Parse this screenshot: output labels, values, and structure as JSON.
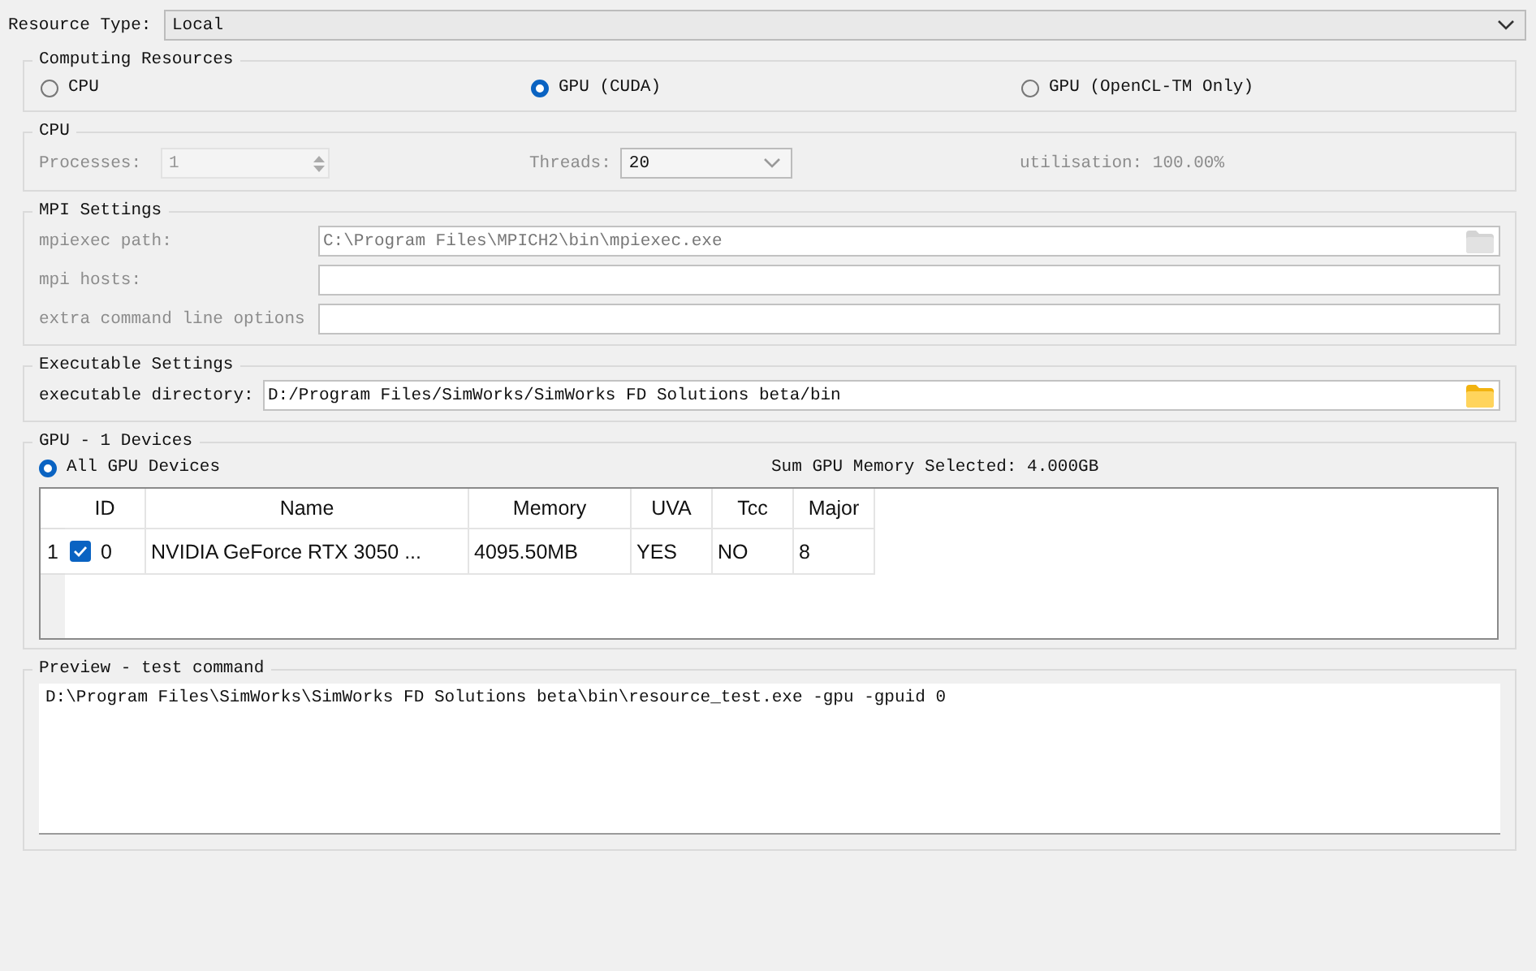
{
  "resource_type": {
    "label": "Resource Type:",
    "value": "Local"
  },
  "computing_resources": {
    "title": "Computing Resources",
    "options": [
      {
        "label": "CPU",
        "selected": false
      },
      {
        "label": "GPU (CUDA)",
        "selected": true
      },
      {
        "label": "GPU (OpenCL-TM Only)",
        "selected": false
      }
    ]
  },
  "cpu": {
    "title": "CPU",
    "processes_label": "Processes:",
    "processes_value": "1",
    "processes_disabled": true,
    "threads_label": "Threads:",
    "threads_value": "20",
    "utilisation": "utilisation: 100.00%"
  },
  "mpi_settings": {
    "title": "MPI Settings",
    "disabled": true,
    "fields": [
      {
        "label": "mpiexec path:",
        "value": "C:\\Program Files\\MPICH2\\bin\\mpiexec.exe",
        "browse": true
      },
      {
        "label": "mpi hosts:",
        "browse": false
      },
      {
        "label": "extra command line options",
        "browse": false
      }
    ]
  },
  "executable_settings": {
    "title": "Executable Settings",
    "label": "executable directory:",
    "value": "D:/Program Files/SimWorks/SimWorks FD Solutions beta/bin"
  },
  "gpu": {
    "title": "GPU - 1 Devices",
    "all_devices": {
      "label": "All GPU Devices",
      "selected": true
    },
    "sum_memory": "Sum GPU Memory Selected: 4.000GB",
    "table": {
      "columns": [
        "ID",
        "Name",
        "Memory",
        "UVA",
        "Tcc",
        "Major"
      ],
      "rows": [
        {
          "index": "1",
          "checked": true,
          "cells": [
            "0",
            "NVIDIA GeForce RTX 3050 ...",
            "4095.50MB",
            "YES",
            "NO",
            "8"
          ]
        }
      ]
    }
  },
  "preview": {
    "title": "Preview - test command",
    "command": "D:\\Program Files\\SimWorks\\SimWorks FD Solutions beta\\bin\\resource_test.exe -gpu -gpuid 0"
  }
}
